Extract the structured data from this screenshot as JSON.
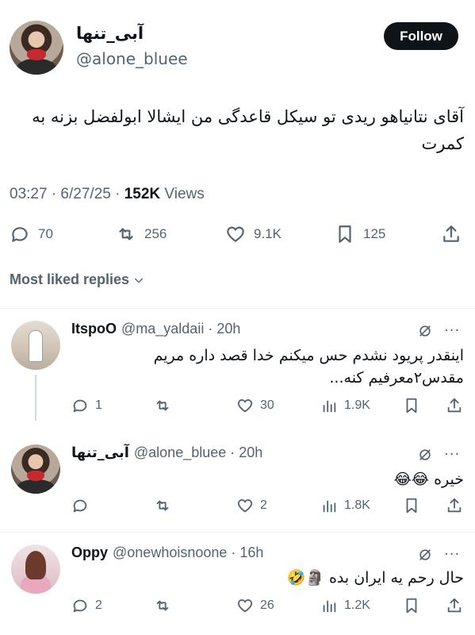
{
  "tweet": {
    "display_name": "آبی_تنها",
    "handle": "@alone_bluee",
    "follow_label": "Follow",
    "text": "آقای نتانیاهو ریدی تو سیکل قاعدگی من ایشالا ابولفضل بزنه به کمرت",
    "time": "03:27 · 6/27/25 · ",
    "views_count": "152K",
    "views_label": " Views",
    "stats": {
      "replies": "70",
      "retweets": "256",
      "likes": "9.1K",
      "bookmarks": "125"
    }
  },
  "replies_sort_label": "Most liked replies",
  "replies": [
    {
      "name": "ItspoO",
      "handle": "@ma_yaldaii · 20h",
      "text": "اینقدر پریود نشدم حس میکنم خدا قصد داره مریم مقدس۲معرفیم کنه...",
      "replies": "1",
      "retweets": "",
      "likes": "30",
      "views": "1.9K"
    },
    {
      "name": "آبی_تنها",
      "handle": "@alone_bluee · 20h",
      "text": "خیره 😂😂",
      "replies": "",
      "retweets": "",
      "likes": "2",
      "views": "1.8K"
    },
    {
      "name": "Oppy",
      "handle": "@onewhoisnoone · 16h",
      "text": "حال رحم یه ایران بده 🗿🤣",
      "replies": "2",
      "retweets": "",
      "likes": "26",
      "views": "1.2K"
    }
  ]
}
